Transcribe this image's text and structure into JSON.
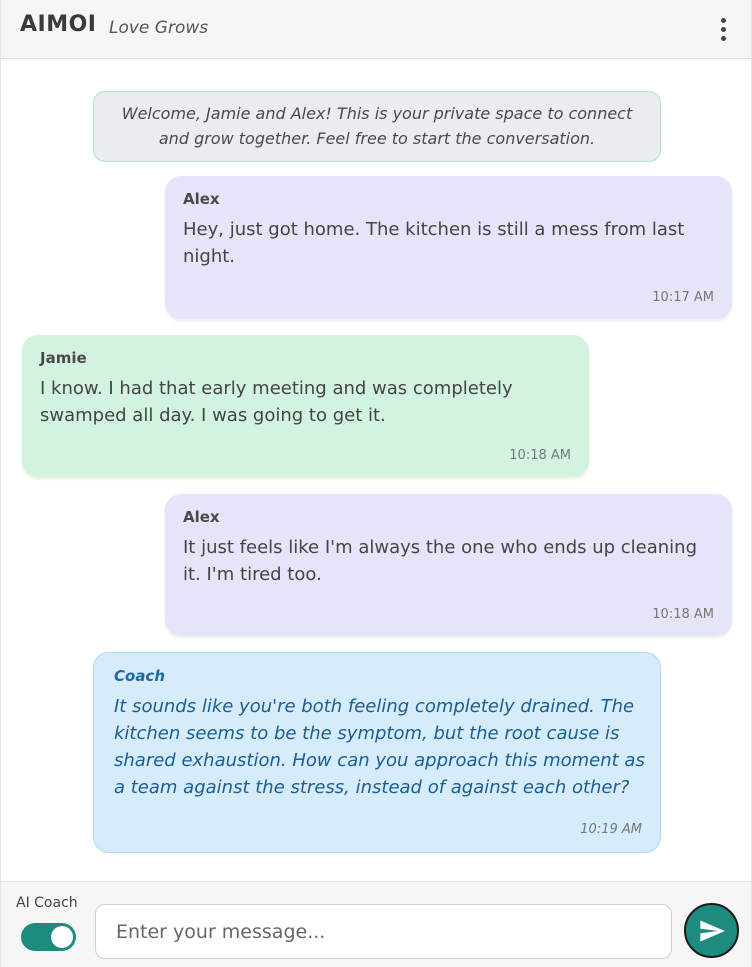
{
  "header": {
    "brand": "AIMOI",
    "tagline": "Love Grows",
    "menu_icon": "more-vertical-icon"
  },
  "chat": {
    "welcome": "Welcome, Jamie and Alex! This is your private space to connect and grow together. Feel free to start the conversation.",
    "messages": [
      {
        "sender": "Alex",
        "text": "Hey, just got home. The kitchen is still a mess from last night.",
        "time": "10:17 AM"
      },
      {
        "sender": "Jamie",
        "text": "I know. I had that early meeting and was completely swamped all day. I was going to get it.",
        "time": "10:18 AM"
      },
      {
        "sender": "Alex",
        "text": "It just feels like I'm always the one who ends up cleaning it. I'm tired too.",
        "time": "10:18 AM"
      },
      {
        "sender": "Coach",
        "text": "It sounds like you're both feeling completely drained. The kitchen seems to be the symptom, but the root cause is shared exhaustion. How can you approach this moment as a team against the stress, instead of against each other?",
        "time": "10:19 AM"
      }
    ]
  },
  "footer": {
    "coach_label": "AI Coach",
    "coach_enabled": true,
    "input_placeholder": "Enter your message...",
    "input_value": "",
    "send_icon": "send-arrow-icon"
  },
  "colors": {
    "accent": "#1e8b7f",
    "alex_bubble": "#e4e5f8",
    "jamie_bubble": "#d3f3e1",
    "coach_bubble": "#d6ecfb",
    "coach_text": "#1b5e90"
  }
}
